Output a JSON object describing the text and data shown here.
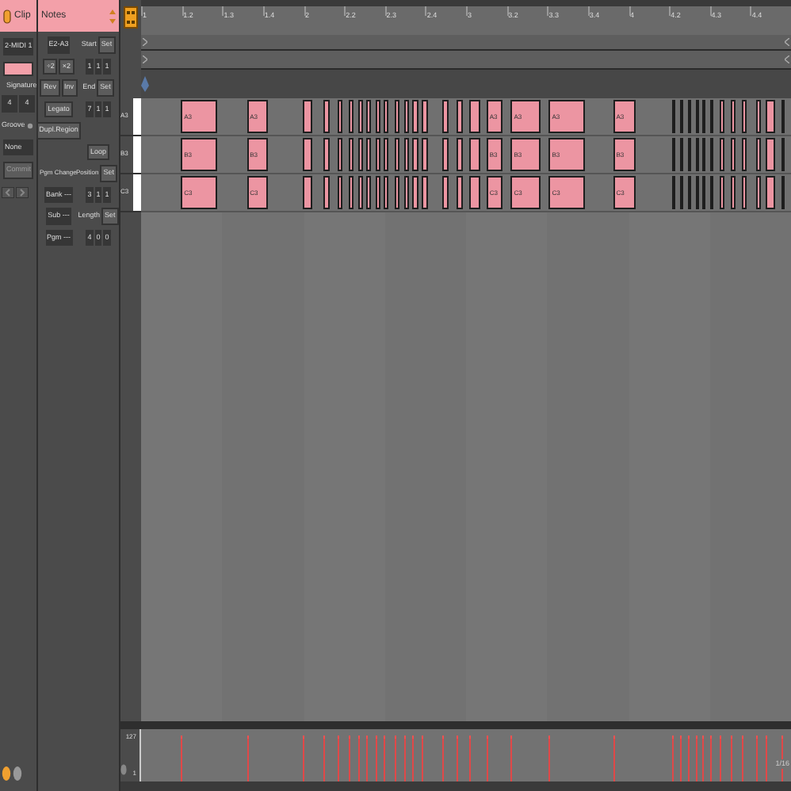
{
  "clip": {
    "title": "Clip",
    "name": "2-MIDI 1",
    "signature_label": "Signature",
    "signature": [
      "4",
      "4"
    ],
    "groove_label": "Groove",
    "groove": "None",
    "commit": "Commit"
  },
  "notes_panel": {
    "title": "Notes",
    "range": "E2-A3",
    "halve": "÷2",
    "double": "×2",
    "reverse": "Rev",
    "invert": "Inv",
    "legato": "Legato",
    "duplicate": "Dupl.Region",
    "pgm_change": "Pgm Change",
    "bank": "Bank ---",
    "sub": "Sub ---",
    "pgm": "Pgm ---",
    "start": {
      "label": "Start",
      "set": "Set",
      "values": [
        "1",
        "1",
        "1"
      ]
    },
    "end": {
      "label": "End",
      "set": "Set",
      "values": [
        "7",
        "1",
        "1"
      ]
    },
    "loop": "Loop",
    "position": {
      "label": "Position",
      "set": "Set",
      "values": [
        "3",
        "1",
        "1"
      ]
    },
    "length": {
      "label": "Length",
      "set": "Set",
      "values": [
        "4",
        "0",
        "0"
      ]
    }
  },
  "ruler": [
    "1",
    "1.2",
    "1.3",
    "1.4",
    "2",
    "2.2",
    "2.3",
    "2.4",
    "3",
    "3.2",
    "3.3",
    "3.4",
    "4",
    "4.2",
    "4.3",
    "4.4"
  ],
  "rows": [
    {
      "key_label": "A3",
      "notes": [
        {
          "kind": "labeled",
          "label": "A3"
        },
        {
          "kind": "labeled",
          "label": "A3"
        },
        {
          "kind": "plain"
        },
        {
          "kind": "plain"
        },
        {
          "kind": "plain"
        },
        {
          "kind": "plain"
        },
        {
          "kind": "plain"
        },
        {
          "kind": "plain"
        },
        {
          "kind": "plain"
        },
        {
          "kind": "plain"
        },
        {
          "kind": "plain"
        },
        {
          "kind": "plain"
        },
        {
          "kind": "plain"
        },
        {
          "kind": "plain"
        },
        {
          "kind": "plain"
        },
        {
          "kind": "plain"
        },
        {
          "kind": "plain"
        },
        {
          "kind": "labeled",
          "label": "A3"
        },
        {
          "kind": "labeled",
          "label": "A3"
        },
        {
          "kind": "labeled",
          "label": "A3"
        },
        {
          "kind": "labeled",
          "label": "A3"
        },
        {
          "kind": "plain"
        },
        {
          "kind": "plain"
        },
        {
          "kind": "plain"
        },
        {
          "kind": "plain"
        },
        {
          "kind": "plain"
        },
        {
          "kind": "plain"
        },
        {
          "kind": "plain"
        },
        {
          "kind": "plain"
        },
        {
          "kind": "plain"
        },
        {
          "kind": "plain"
        },
        {
          "kind": "plain"
        },
        {
          "kind": "plain"
        }
      ]
    },
    {
      "key_label": "B3",
      "notes": [
        {
          "kind": "labeled",
          "label": "B3"
        },
        {
          "kind": "labeled",
          "label": "B3"
        },
        {
          "kind": "plain"
        },
        {
          "kind": "plain"
        },
        {
          "kind": "plain"
        },
        {
          "kind": "plain"
        },
        {
          "kind": "plain"
        },
        {
          "kind": "plain"
        },
        {
          "kind": "plain"
        },
        {
          "kind": "plain"
        },
        {
          "kind": "plain"
        },
        {
          "kind": "plain"
        },
        {
          "kind": "plain"
        },
        {
          "kind": "plain"
        },
        {
          "kind": "plain"
        },
        {
          "kind": "plain"
        },
        {
          "kind": "plain"
        },
        {
          "kind": "labeled",
          "label": "B3"
        },
        {
          "kind": "labeled",
          "label": "B3"
        },
        {
          "kind": "labeled",
          "label": "B3"
        },
        {
          "kind": "labeled",
          "label": "B3"
        },
        {
          "kind": "plain"
        },
        {
          "kind": "plain"
        },
        {
          "kind": "plain"
        },
        {
          "kind": "plain"
        },
        {
          "kind": "plain"
        },
        {
          "kind": "plain"
        },
        {
          "kind": "plain"
        },
        {
          "kind": "plain"
        },
        {
          "kind": "plain"
        },
        {
          "kind": "plain"
        },
        {
          "kind": "plain"
        },
        {
          "kind": "plain"
        }
      ]
    },
    {
      "key_label": "C3",
      "notes": [
        {
          "kind": "labeled",
          "label": "C3"
        },
        {
          "kind": "labeled",
          "label": "C3"
        },
        {
          "kind": "plain"
        },
        {
          "kind": "plain"
        },
        {
          "kind": "plain"
        },
        {
          "kind": "plain"
        },
        {
          "kind": "plain"
        },
        {
          "kind": "plain"
        },
        {
          "kind": "plain"
        },
        {
          "kind": "plain"
        },
        {
          "kind": "plain"
        },
        {
          "kind": "plain"
        },
        {
          "kind": "plain"
        },
        {
          "kind": "plain"
        },
        {
          "kind": "plain"
        },
        {
          "kind": "plain"
        },
        {
          "kind": "plain"
        },
        {
          "kind": "labeled",
          "label": "C3"
        },
        {
          "kind": "labeled",
          "label": "C3"
        },
        {
          "kind": "labeled",
          "label": "C3"
        },
        {
          "kind": "labeled",
          "label": "C3"
        },
        {
          "kind": "plain"
        },
        {
          "kind": "plain"
        },
        {
          "kind": "plain"
        },
        {
          "kind": "plain"
        },
        {
          "kind": "plain"
        },
        {
          "kind": "plain"
        },
        {
          "kind": "plain"
        },
        {
          "kind": "plain"
        },
        {
          "kind": "plain"
        },
        {
          "kind": "plain"
        },
        {
          "kind": "plain"
        },
        {
          "kind": "plain"
        }
      ]
    }
  ],
  "velocity": {
    "max": "127",
    "min": "1",
    "grid": "1/16"
  }
}
